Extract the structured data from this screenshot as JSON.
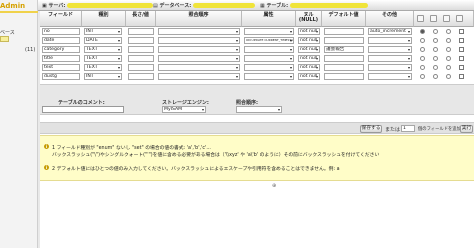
{
  "sidebar": {
    "brand": "Admin",
    "nav_text": "ベース",
    "count": "(11)"
  },
  "breadcrumbs": [
    {
      "label": "サーバ:"
    },
    {
      "label": "データベース:"
    },
    {
      "label": "テーブル:"
    }
  ],
  "columns": [
    "フィールド",
    "種別",
    "長さ/値",
    "照合順序",
    "属性",
    "ヌル (NULL)",
    "デフォルト値",
    "その他"
  ],
  "rows": [
    {
      "field": "no",
      "type": "INT",
      "length": "",
      "collation": "",
      "attribute": "",
      "null": "not null",
      "default": "",
      "extra": "auto_increment",
      "primary": true
    },
    {
      "field": "date",
      "type": "DATE",
      "length": "",
      "collation": "",
      "attribute": "ON UPDATE CURRENT_TIMESTAMP",
      "null": "not null",
      "default": "",
      "extra": "",
      "primary": false
    },
    {
      "field": "category",
      "type": "TEXT",
      "length": "",
      "collation": "",
      "attribute": "",
      "null": "not null",
      "default": "議会報告",
      "extra": "",
      "primary": false
    },
    {
      "field": "title",
      "type": "TEXT",
      "length": "",
      "collation": "",
      "attribute": "",
      "null": "not null",
      "default": "",
      "extra": "",
      "primary": false
    },
    {
      "field": "text",
      "type": "TEXT",
      "length": "",
      "collation": "",
      "attribute": "",
      "null": "not null",
      "default": "",
      "extra": "",
      "primary": false
    },
    {
      "field": "dustg",
      "type": "INT",
      "length": "",
      "collation": "",
      "attribute": "",
      "null": "not null",
      "default": "",
      "extra": "",
      "primary": false
    }
  ],
  "table_options": {
    "comment_label": "テーブルのコメント:",
    "engine_label": "ストレージエンジン:",
    "engine_value": "MyISAM",
    "collation_label": "照合順序:"
  },
  "actions": {
    "save_label": "保存する",
    "or_label": "または",
    "add_count": "1",
    "add_suffix": "個のフィールドを追加する",
    "go_label": "実行"
  },
  "notes": [
    {
      "num": "1",
      "text": "フィールド種別が \"enum\" ないし \"set\" の場合の値の書式: 'a','b','c'..."
    },
    {
      "num": "",
      "text": "バックスラッシュ(\"\\\")やシングルクォート(\"'\")を値に含める必要がある場合は（'\\\\xyz' や 'a\\'b' のように）その前にバックスラッシュを付けてください"
    },
    {
      "num": "2",
      "text": "デフォルト値にはひとつの値のみ入力してください。バックスラッシュによるエスケープや引用符を含めることはできません。例: a"
    }
  ],
  "colors": {
    "accent": "#f0d24a",
    "note_bg": "#fffdc8"
  }
}
